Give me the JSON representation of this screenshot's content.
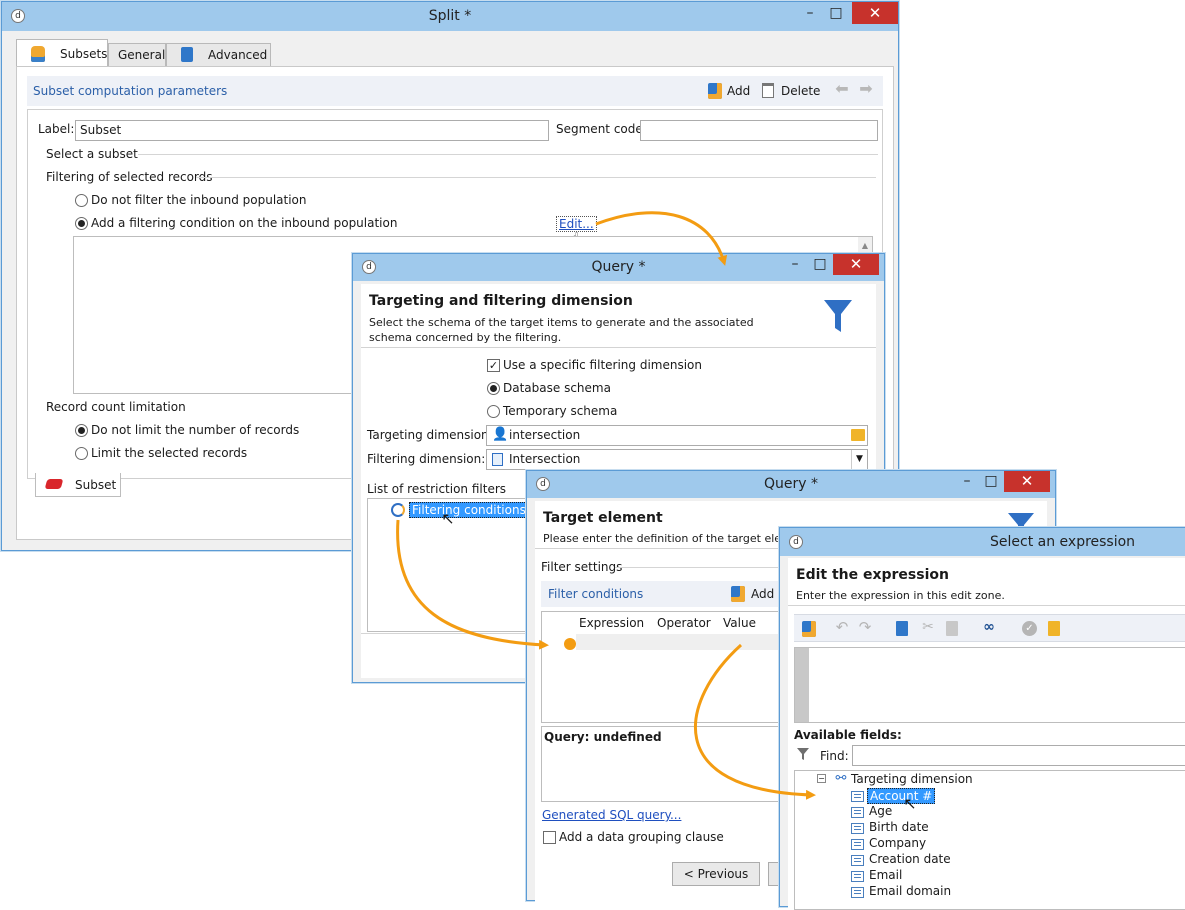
{
  "split": {
    "title": "Split *",
    "tabs": [
      "Subsets",
      "General",
      "Advanced"
    ],
    "section_title": "Subset computation parameters",
    "add_label": "Add",
    "delete_label": "Delete",
    "label_label": "Label:",
    "label_value": "Subset",
    "segment_label": "Segment code:",
    "segment_value": "",
    "select_subset": "Select a subset",
    "filtering_title": "Filtering of selected records",
    "opt_no_filter": "Do not filter the inbound population",
    "opt_add_filter": "Add a filtering condition on the inbound population",
    "edit_link": "Edit...",
    "record_limit_title": "Record count limitation",
    "opt_no_limit": "Do not limit the number of records",
    "opt_limit": "Limit the selected records",
    "bottom_tab": "Subset"
  },
  "query1": {
    "title": "Query *",
    "heading": "Targeting and filtering dimension",
    "description": "Select the schema of the target items to  generate and the associated schema concerned by the filtering.",
    "use_specific": "Use a specific filtering dimension",
    "db_schema": "Database schema",
    "temp_schema": "Temporary schema",
    "targeting_label": "Targeting dimension:",
    "targeting_value": "intersection",
    "filtering_label": "Filtering dimension:",
    "filtering_value": "Intersection",
    "restriction_title": "List of restriction filters",
    "filter_item": "Filtering conditions"
  },
  "query2": {
    "title": "Query *",
    "heading": "Target element",
    "description": "Please enter the definition of the target elem",
    "filter_settings": "Filter settings",
    "filter_conditions": "Filter conditions",
    "add_label": "Add",
    "columns": [
      "Expression",
      "Operator",
      "Value"
    ],
    "query_status": "Query: undefined",
    "sql_link": "Generated SQL query...",
    "grouping": "Add a data grouping clause",
    "prev_button": "< Previous"
  },
  "expr": {
    "title": "Select an expression",
    "heading": "Edit the expression",
    "description": "Enter the expression in this edit zone.",
    "available": "Available fields:",
    "find_label": "Find:",
    "find_value": "",
    "root": "Targeting dimension",
    "fields": [
      "Account #",
      "Age",
      "Birth date",
      "Company",
      "Creation date",
      "Email",
      "Email domain"
    ]
  },
  "colors": {
    "titlebar": "#9fc9ec",
    "close": "#c7322c",
    "accent": "#2b5fa8",
    "arrow": "#f39c12",
    "selection": "#3399ff"
  }
}
